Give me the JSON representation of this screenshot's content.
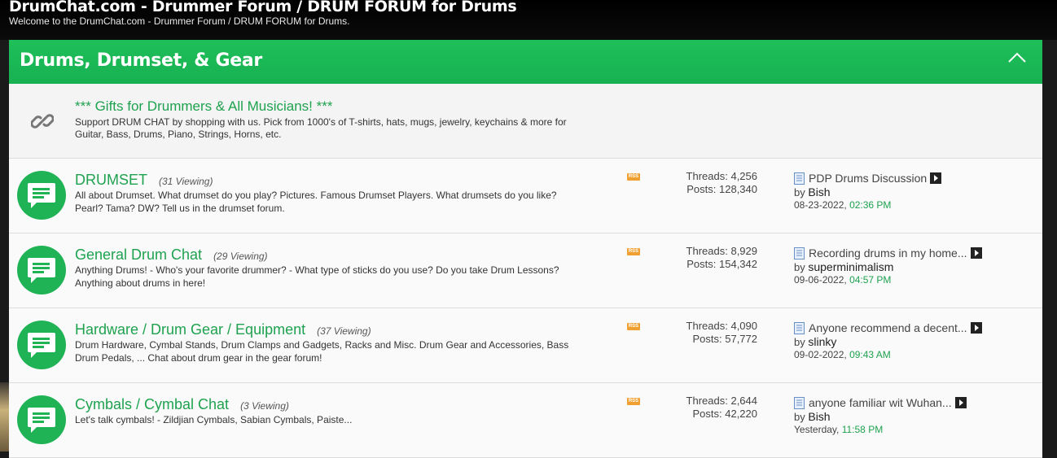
{
  "site": {
    "title": "DrumChat.com - Drummer Forum / DRUM FORUM for Drums",
    "subtitle": "Welcome to the DrumChat.com - Drummer Forum / DRUM FORUM for Drums."
  },
  "category": {
    "title": "Drums, Drumset, & Gear",
    "collapse_icon": "chevron-up-icon"
  },
  "link_forum": {
    "icon": "link-icon",
    "title": "*** Gifts for Drummers & All Musicians! ***",
    "description": "Support DRUM CHAT by shopping with us. Pick from 1000's of T-shirts, hats, mugs, jewelry, keychains & more for Guitar, Bass, Drums, Piano, Strings, Horns, etc."
  },
  "forums": [
    {
      "name": "DRUMSET",
      "viewing": "(31 Viewing)",
      "description": "All about Drumset. What drumset do you play? Pictures. Famous Drumset Players. What drumsets do you like? Pearl? Tama? DW? Tell us in the drumset forum.",
      "rss": "RSS",
      "threads": "Threads: 4,256",
      "posts": "Posts: 128,340",
      "last_post_title": "PDP Drums Discussion",
      "by_label": "by",
      "last_post_user": "Bish",
      "last_post_date": "08-23-2022,",
      "last_post_time": "02:36 PM"
    },
    {
      "name": "General Drum Chat",
      "viewing": "(29 Viewing)",
      "description": "Anything Drums! - Who's your favorite drummer? - What type of sticks do you use? Do you take Drum Lessons? Anything about drums in here!",
      "rss": "RSS",
      "threads": "Threads: 8,929",
      "posts": "Posts: 154,342",
      "last_post_title": "Recording drums in my home...",
      "by_label": "by",
      "last_post_user": "superminimalism",
      "last_post_date": "09-06-2022,",
      "last_post_time": "04:57 PM"
    },
    {
      "name": "Hardware / Drum Gear / Equipment",
      "viewing": "(37 Viewing)",
      "description": "Drum Hardware, Cymbal Stands, Drum Clamps and Gadgets, Racks and Misc. Drum Gear and Accessories, Bass Drum Pedals, ... Chat about drum gear in the gear forum!",
      "rss": "RSS",
      "threads": "Threads: 4,090",
      "posts": "Posts: 57,772",
      "last_post_title": "Anyone recommend a decent...",
      "by_label": "by",
      "last_post_user": "slinky",
      "last_post_date": "09-02-2022,",
      "last_post_time": "09:43 AM"
    },
    {
      "name": "Cymbals / Cymbal Chat",
      "viewing": "(3 Viewing)",
      "description": "Let's talk cymbals! - Zildjian Cymbals, Sabian Cymbals, Paiste...",
      "rss": "RSS",
      "threads": "Threads: 2,644",
      "posts": "Posts: 42,220",
      "last_post_title": "anyone familiar wit Wuhan...",
      "by_label": "by",
      "last_post_user": "Bish",
      "last_post_date": "Yesterday,",
      "last_post_time": "11:58 PM"
    }
  ],
  "colors": {
    "accent_green": "#1fbf5a",
    "link_green": "#1fa24f",
    "rss_orange": "#f0a030"
  }
}
